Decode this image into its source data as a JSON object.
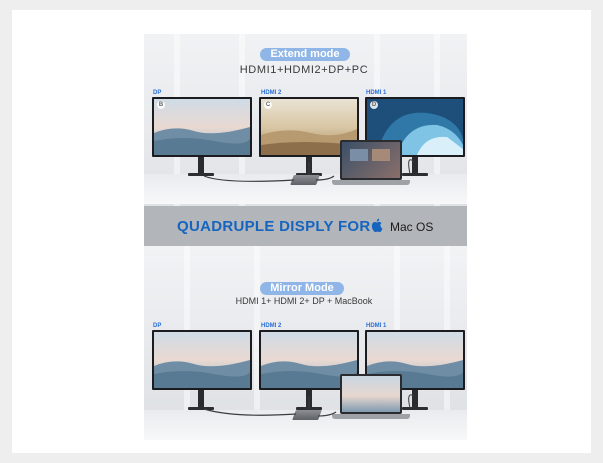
{
  "extend": {
    "pill": "Extend mode",
    "subtitle": "HDMI1+HDMI2+DP+PC",
    "labels": [
      "DP",
      "HDMI 2",
      "HDMI 1"
    ],
    "badges": [
      "B",
      "C",
      "D"
    ]
  },
  "banner": {
    "main": "QUADRUPLE DISPLY FOR",
    "os": "Mac OS"
  },
  "mirror": {
    "pill": "Mirror Mode",
    "subtitle": "HDMI 1+ HDMI 2+ DP + MacBook",
    "labels": [
      "DP",
      "HDMI 2",
      "HDMI 1"
    ]
  },
  "colors": {
    "accent_pill": "#8fb6e6",
    "banner_text": "#1565c0",
    "label_text": "#2a6fd6",
    "banner_bg": "#b2b5b9"
  },
  "icons": [
    "apple-logo-icon",
    "usb-c-hub-icon",
    "laptop-icon",
    "monitor-icon"
  ]
}
